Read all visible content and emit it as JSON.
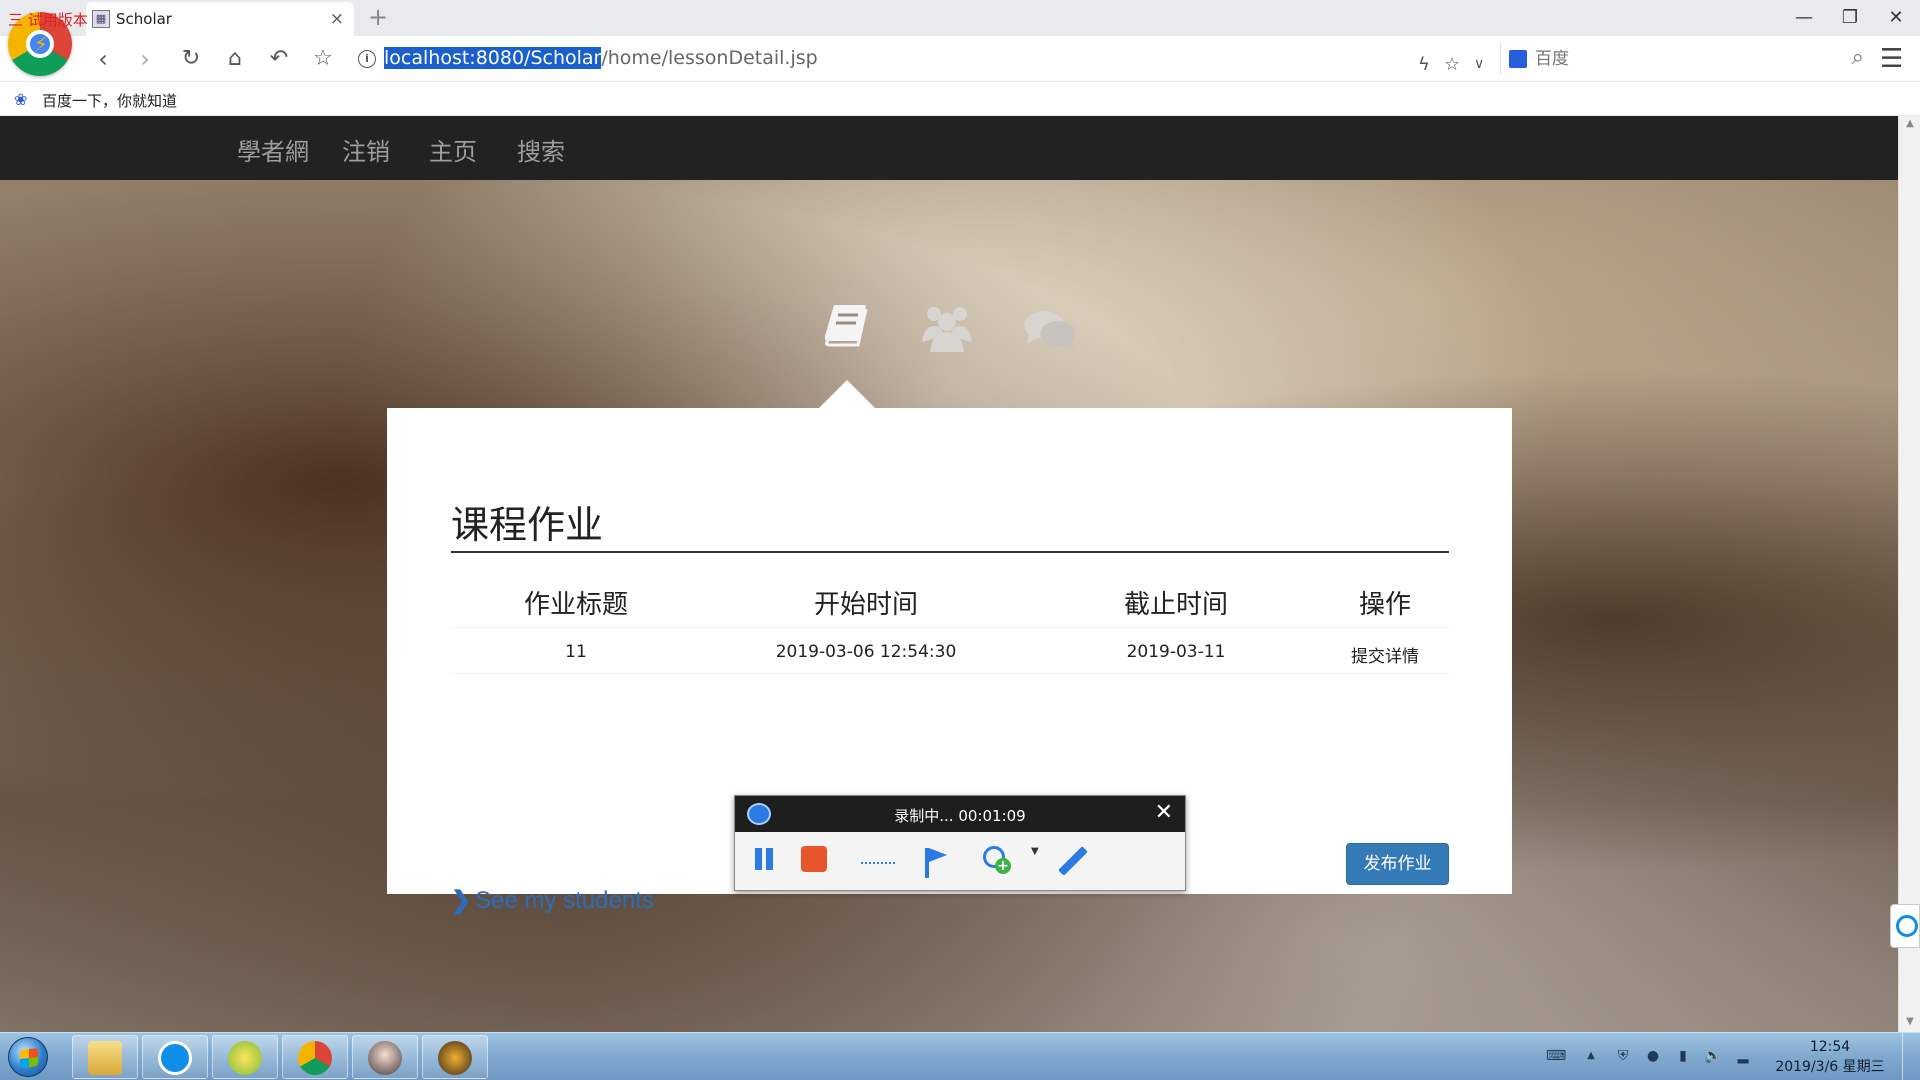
{
  "browser": {
    "trial_label": "三 试用版本",
    "tab_title": "Scholar",
    "tab_close": "×",
    "new_tab": "+",
    "window_controls": {
      "minimize": "—",
      "restore": "❐",
      "close": "✕"
    },
    "url_selected": "localhost:8080/Scholar",
    "url_rest": "/home/lessonDetail.jsp",
    "search_placeholder": "百度",
    "bookmark_label": "百度一下，你就知道",
    "icons": [
      "back-icon",
      "forward-icon",
      "reload-icon",
      "home-icon",
      "undo-icon",
      "star-icon",
      "info-icon",
      "lightning-icon",
      "search-icon",
      "menu-icon"
    ]
  },
  "site_nav": {
    "items": [
      "學者網",
      "注销",
      "主页",
      "搜索"
    ]
  },
  "panel": {
    "title": "课程作业",
    "columns": [
      "作业标题",
      "开始时间",
      "截止时间",
      "操作"
    ],
    "rows": [
      {
        "title": "11",
        "start": "2019-03-06 12:54:30",
        "end": "2019-03-11",
        "action": "提交详情"
      }
    ],
    "publish_button": "发布作业",
    "students_link": "See my students"
  },
  "recorder": {
    "status": "录制中... 00:01:09",
    "close": "✕"
  },
  "taskbar": {
    "clock_time": "12:54",
    "clock_date": "2019/3/6 星期三"
  },
  "colors": {
    "nav_bg": "#222222",
    "link": "#337ab7",
    "button": "#337ab7",
    "url_selection": "#1a5fd0"
  }
}
